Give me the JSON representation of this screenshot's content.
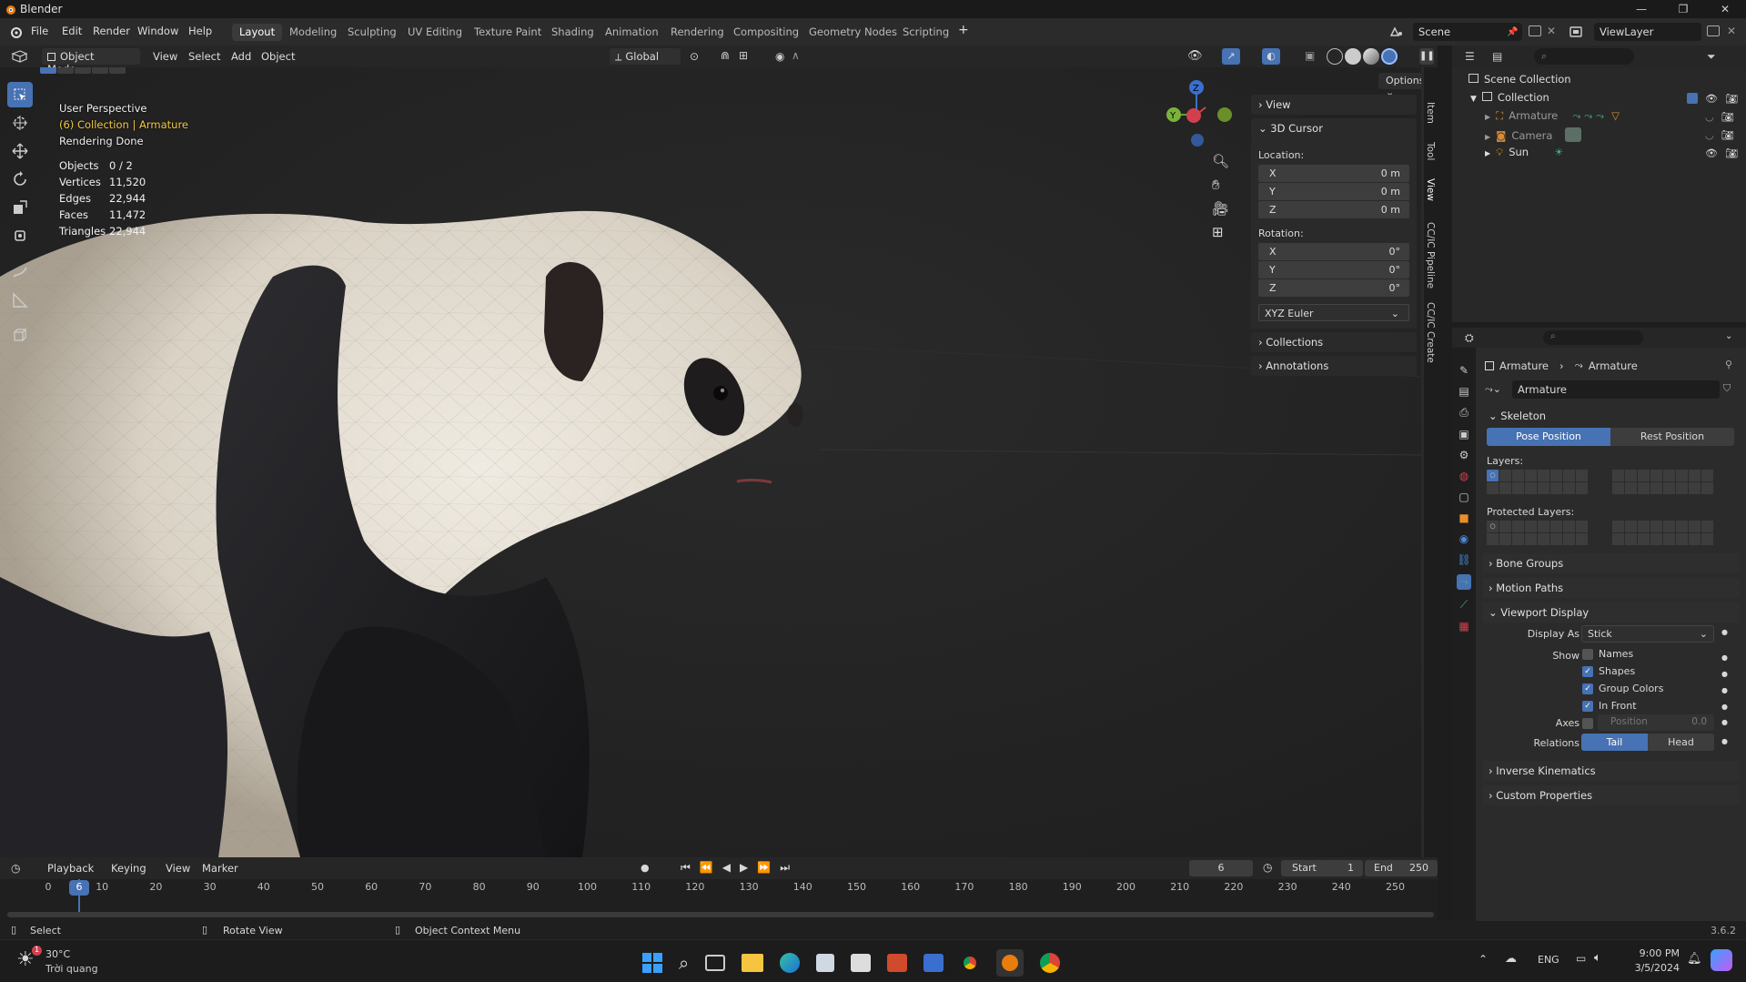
{
  "window": {
    "title": "Blender"
  },
  "menu": [
    "File",
    "Edit",
    "Render",
    "Window",
    "Help"
  ],
  "workspaces": [
    "Layout",
    "Modeling",
    "Sculpting",
    "UV Editing",
    "Texture Paint",
    "Shading",
    "Animation",
    "Rendering",
    "Compositing",
    "Geometry Nodes",
    "Scripting"
  ],
  "scene": {
    "name": "Scene",
    "view_layer": "ViewLayer"
  },
  "viewport_header": {
    "mode": "Object Mode",
    "menus": [
      "View",
      "Select",
      "Add",
      "Object"
    ],
    "transform_orientation": "Global",
    "options": "Options"
  },
  "overlay": {
    "perspective": "User Perspective",
    "collection": "(6) Collection | Armature",
    "render_status": "Rendering Done",
    "stats": [
      {
        "label": "Objects",
        "value": "0 / 2"
      },
      {
        "label": "Vertices",
        "value": "11,520"
      },
      {
        "label": "Edges",
        "value": "22,944"
      },
      {
        "label": "Faces",
        "value": "11,472"
      },
      {
        "label": "Triangles",
        "value": "22,944"
      }
    ]
  },
  "npanel": {
    "view": "View",
    "cursor": "3D Cursor",
    "location_label": "Location:",
    "location": [
      {
        "axis": "X",
        "value": "0 m"
      },
      {
        "axis": "Y",
        "value": "0 m"
      },
      {
        "axis": "Z",
        "value": "0 m"
      }
    ],
    "rotation_label": "Rotation:",
    "rotation": [
      {
        "axis": "X",
        "value": "0°"
      },
      {
        "axis": "Y",
        "value": "0°"
      },
      {
        "axis": "Z",
        "value": "0°"
      }
    ],
    "rotation_mode": "XYZ Euler",
    "collections": "Collections",
    "annotations": "Annotations",
    "tabs": [
      "Item",
      "Tool",
      "View",
      "CC/IC Pipeline",
      "CC/IC Create"
    ]
  },
  "outliner": {
    "root": "Scene Collection",
    "collection": "Collection",
    "items": [
      "Armature",
      "Camera",
      "Sun"
    ]
  },
  "properties": {
    "breadcrumb_object": "Armature",
    "breadcrumb_data": "Armature",
    "data_name": "Armature",
    "skeleton": "Skeleton",
    "pose_position": "Pose Position",
    "rest_position": "Rest Position",
    "layers_label": "Layers:",
    "protected_layers_label": "Protected Layers:",
    "bone_groups": "Bone Groups",
    "motion_paths": "Motion Paths",
    "viewport_display": "Viewport Display",
    "display_as_label": "Display As",
    "display_as": "Stick",
    "show_label": "Show",
    "show": [
      {
        "label": "Names",
        "checked": false
      },
      {
        "label": "Shapes",
        "checked": true
      },
      {
        "label": "Group Colors",
        "checked": true
      },
      {
        "label": "In Front",
        "checked": true
      }
    ],
    "axes_label": "Axes",
    "axes_position_label": "Position",
    "axes_position_value": "0.0",
    "relations_label": "Relations",
    "relations_tail": "Tail",
    "relations_head": "Head",
    "inverse_kinematics": "Inverse Kinematics",
    "custom_properties": "Custom Properties"
  },
  "timeline": {
    "menus": [
      "Playback",
      "Keying",
      "View",
      "Marker"
    ],
    "current_frame": "6",
    "start_label": "Start",
    "start": "1",
    "end_label": "End",
    "end": "250",
    "ticks": [
      "0",
      "10",
      "20",
      "30",
      "40",
      "50",
      "60",
      "70",
      "80",
      "90",
      "100",
      "110",
      "120",
      "130",
      "140",
      "150",
      "160",
      "170",
      "180",
      "190",
      "200",
      "210",
      "220",
      "230",
      "240",
      "250"
    ]
  },
  "statusbar": {
    "select": "Select",
    "rotate": "Rotate View",
    "context": "Object Context Menu",
    "version": "3.6.2"
  },
  "taskbar": {
    "temperature": "30°C",
    "weather": "Trời quang",
    "language": "ENG",
    "time": "9:00 PM",
    "date": "3/5/2024",
    "notify_badge": "1"
  },
  "colors": {
    "accent": "#4772b3",
    "active_text": "#f5c842"
  }
}
